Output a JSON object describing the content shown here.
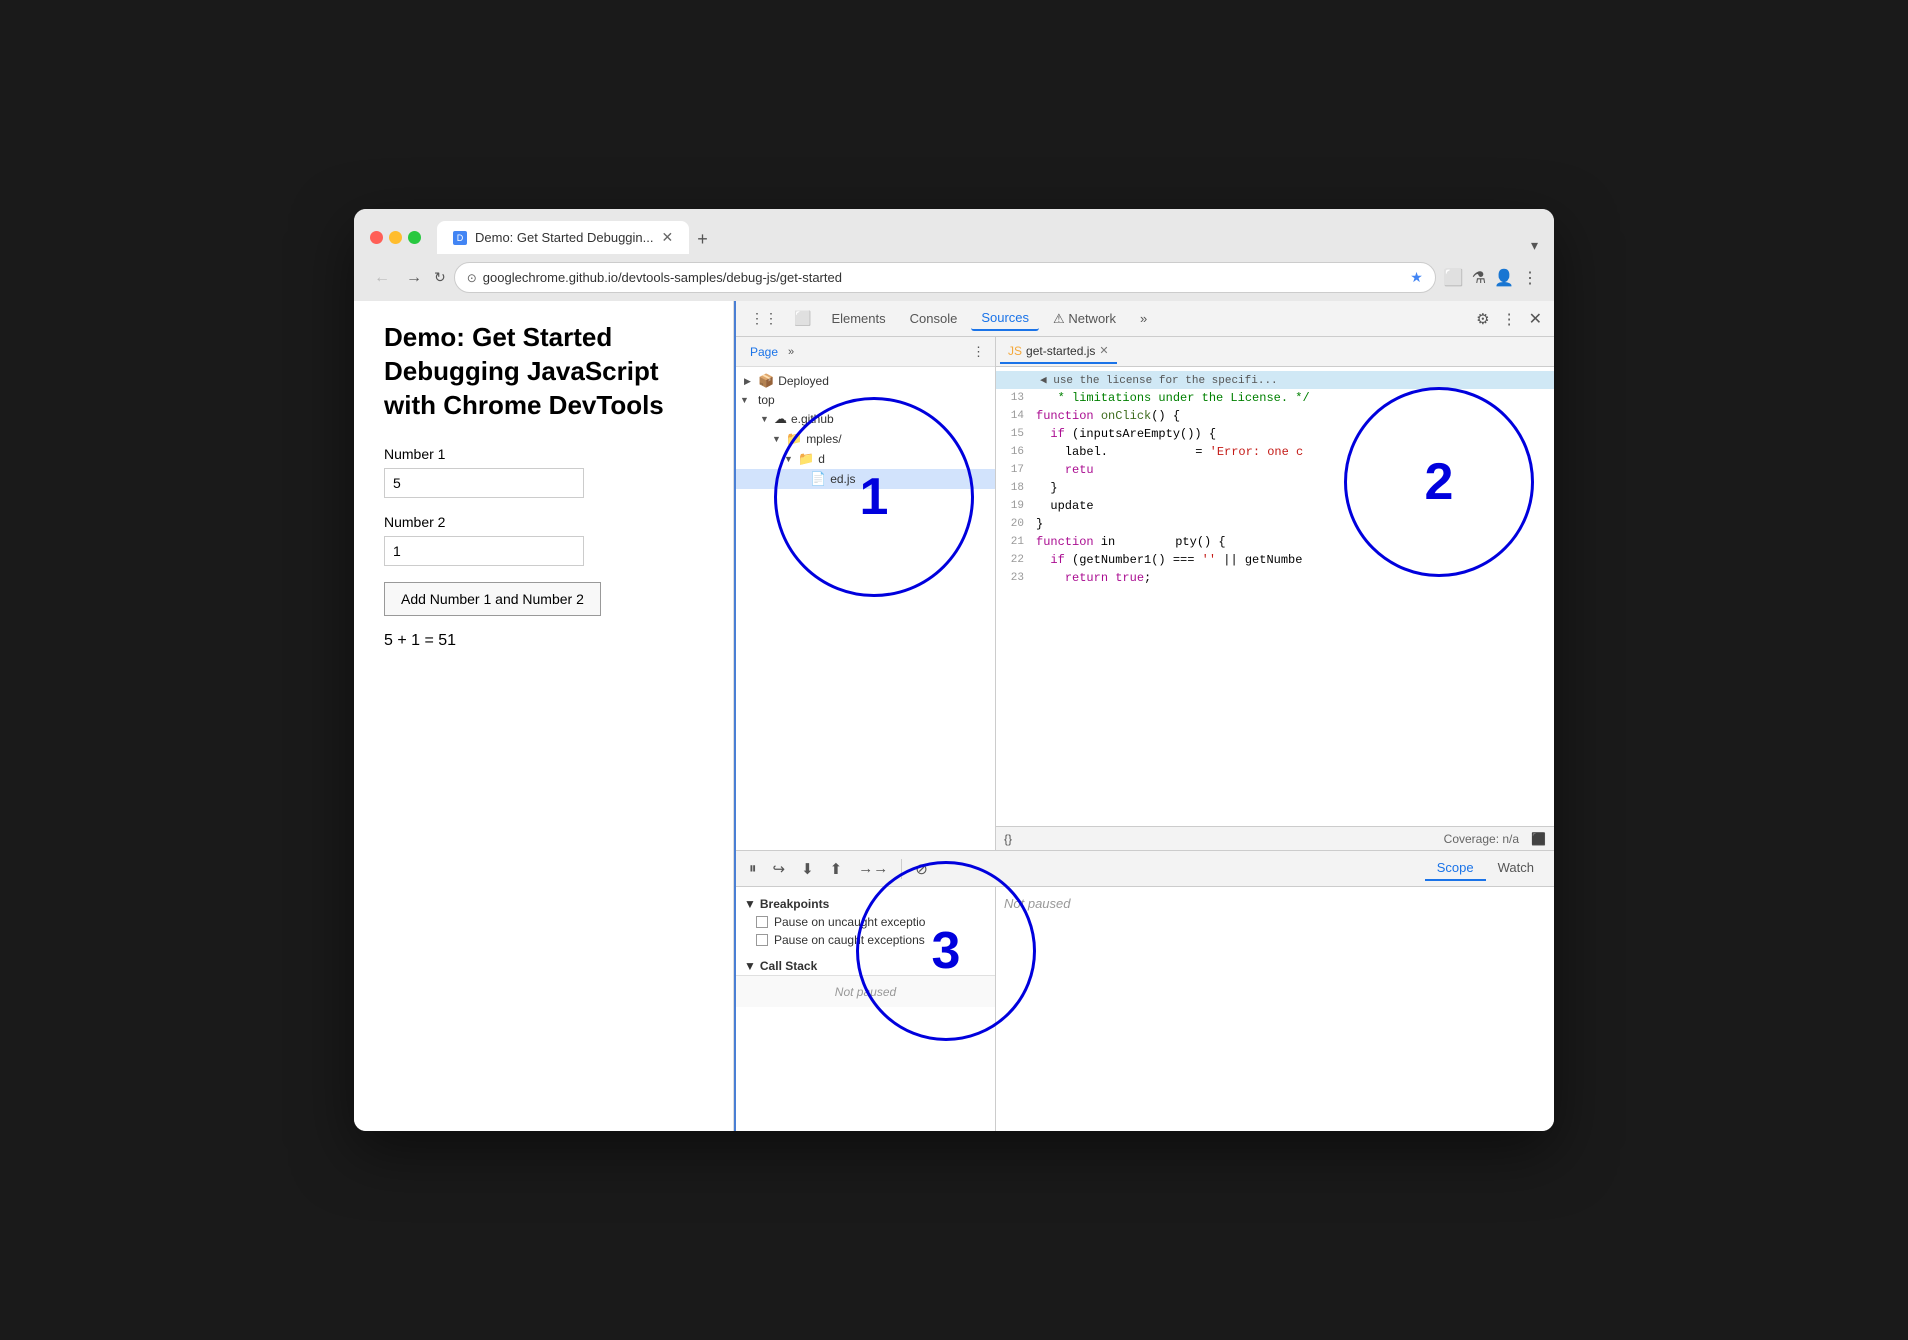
{
  "browser": {
    "tab_title": "Demo: Get Started Debuggin...",
    "tab_favicon": "D",
    "new_tab_label": "+",
    "dropdown_label": "▾",
    "back_button": "←",
    "forward_button": "→",
    "reload_button": "↻",
    "url": "googlechrome.github.io/devtools-samples/debug-js/get-started",
    "star_icon": "★",
    "extensions_icon": "⬜",
    "labs_icon": "⚗",
    "profile_icon": "👤",
    "menu_icon": "⋮"
  },
  "devtools": {
    "toolbar": {
      "inspect_icon": "⋮⋮",
      "device_icon": "⬜",
      "elements_label": "Elements",
      "console_label": "Console",
      "sources_label": "Sources",
      "network_label": "Network",
      "network_warning": "⚠",
      "more_label": "»",
      "gear_icon": "⚙",
      "more_icon": "⋮",
      "close_icon": "✕"
    },
    "file_tree": {
      "page_tab": "Page",
      "more_tab": "»",
      "menu_icon": "⋮",
      "deployed_label": "Deployed",
      "top_label": "top",
      "github_label": "e.github",
      "mples_label": "mples/",
      "d_label": "d",
      "ed_js_label": "ed.js"
    },
    "code_viewer": {
      "file_icon": "JS",
      "tab_label": "get-started.js",
      "close_icon": "✕",
      "lines": [
        {
          "num": "13",
          "content": "   * limitations under the License. */"
        },
        {
          "num": "14",
          "content": "function onClick() {"
        },
        {
          "num": "15",
          "content": "  if (inputsAreEmpty()) {"
        },
        {
          "num": "16",
          "content": "    label.              = 'Error: one c"
        },
        {
          "num": "17",
          "content": "    retu"
        },
        {
          "num": "18",
          "content": "  }"
        },
        {
          "num": "19",
          "content": "  update"
        },
        {
          "num": "20",
          "content": "}"
        },
        {
          "num": "21",
          "content": "function in          pty() {"
        },
        {
          "num": "22",
          "content": "  if (getNumber1() === '' || getNumbe"
        },
        {
          "num": "23",
          "content": "    return true;"
        }
      ],
      "pretty_print": "{}",
      "coverage_label": "Coverage: n/a"
    },
    "debugger": {
      "pause_icon": "⏸",
      "step_over_icon": "↪",
      "step_into_icon": "⬇",
      "step_out_icon": "⬆",
      "step_icon": "→→",
      "deactivate_icon": "⊘",
      "scope_tab": "Scope",
      "watch_tab": "Watch",
      "not_paused_label": "Not paused",
      "breakpoints_header": "Breakpoints",
      "pause_uncaught": "Pause on uncaught exceptio",
      "pause_caught": "Pause on caught exceptions",
      "callstack_header": "Call Stack",
      "not_paused_bottom": "Not paused"
    }
  },
  "webpage": {
    "title": "Demo: Get Started Debugging JavaScript with Chrome DevTools",
    "number1_label": "Number 1",
    "number1_value": "5",
    "number2_label": "Number 2",
    "number2_value": "1",
    "button_label": "Add Number 1 and Number 2",
    "result": "5 + 1 = 51"
  },
  "annotations": {
    "circle1": "1",
    "circle2": "2",
    "circle3": "3"
  }
}
